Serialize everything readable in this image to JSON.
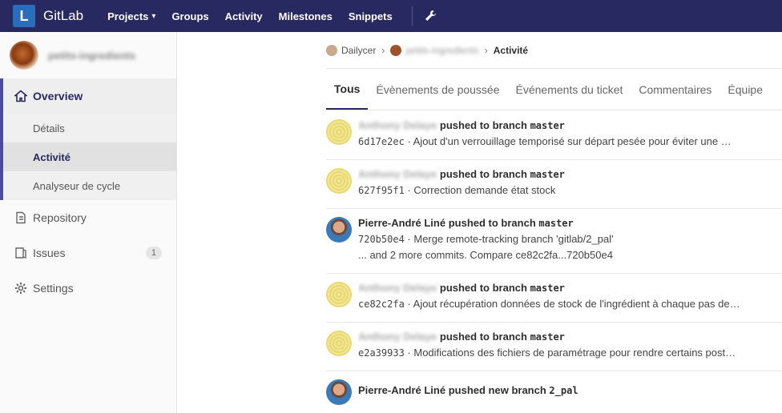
{
  "header": {
    "logo_letter": "L",
    "brand": "GitLab",
    "nav": [
      "Projects",
      "Groups",
      "Activity",
      "Milestones",
      "Snippets"
    ],
    "projects_chevron": "▾"
  },
  "sidebar": {
    "project_name": "petits-ingredients",
    "overview": "Overview",
    "sub_items": [
      "Détails",
      "Activité",
      "Analyseur de cycle"
    ],
    "repository": "Repository",
    "issues": "Issues",
    "issues_count": "1",
    "settings": "Settings"
  },
  "breadcrumb": {
    "group": "Dailycer",
    "project": "petits-ingredients",
    "current": "Activité",
    "sep": "›"
  },
  "tabs": [
    "Tous",
    "Évènements de poussée",
    "Événements du ticket",
    "Commentaires",
    "Équipe"
  ],
  "events": [
    {
      "author": "Anthony Delaye",
      "action": "pushed to branch",
      "branch": "master",
      "sha": "6d17e2ec",
      "message": "· Ajout d'un verrouillage temporisé sur départ pesée pour éviter une …"
    },
    {
      "author": "Anthony Delaye",
      "action": "pushed to branch",
      "branch": "master",
      "sha": "627f95f1",
      "message": "· Correction demande état stock"
    },
    {
      "author": "Pierre-André Liné",
      "action": "pushed to branch",
      "branch": "master",
      "sha": "720b50e4",
      "message": "· Merge remote-tracking branch 'gitlab/2_pal'",
      "extra": "... and 2 more commits. Compare ce82c2fa...720b50e4"
    },
    {
      "author": "Anthony Delaye",
      "action": "pushed to branch",
      "branch": "master",
      "sha": "ce82c2fa",
      "message": "· Ajout récupération données de stock de l'ingrédient à chaque pas de…"
    },
    {
      "author": "Anthony Delaye",
      "action": "pushed to branch",
      "branch": "master",
      "sha": "e2a39933",
      "message": "· Modifications des fichiers de paramétrage pour rendre certains post…"
    },
    {
      "author": "Pierre-André Liné",
      "action": "pushed new branch",
      "branch": "2_pal"
    }
  ]
}
